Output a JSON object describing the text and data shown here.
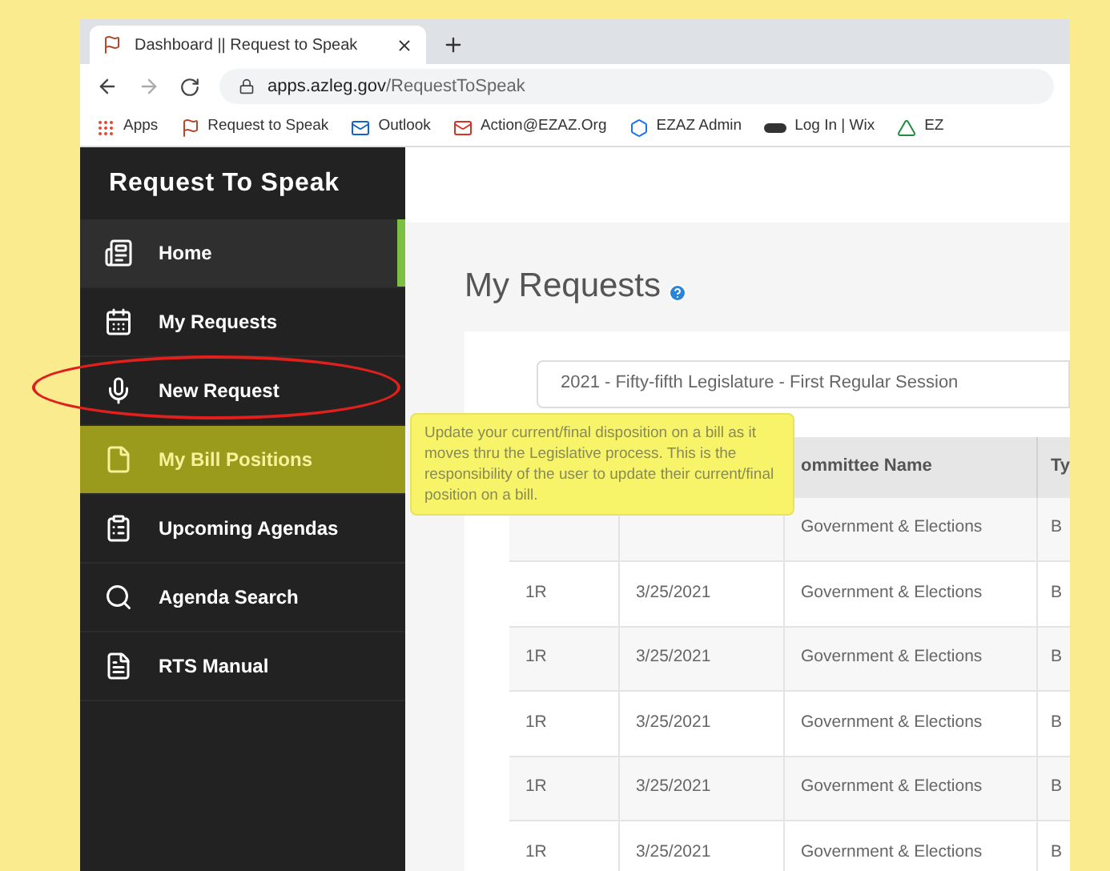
{
  "browser": {
    "tab_title": "Dashboard || Request to Speak",
    "url_domain": "apps.azleg.gov",
    "url_path": "/RequestToSpeak",
    "bookmarks": [
      {
        "label": "Apps",
        "kind": "grid"
      },
      {
        "label": "Request to Speak",
        "kind": "flag"
      },
      {
        "label": "Outlook",
        "kind": "mail"
      },
      {
        "label": "Action@EZAZ.Org",
        "kind": "gmail"
      },
      {
        "label": "EZAZ Admin",
        "kind": "hex"
      },
      {
        "label": "Log In | Wix",
        "kind": "wix"
      },
      {
        "label": "EZ",
        "kind": "drive"
      }
    ]
  },
  "sidebar": {
    "title": "Request To Speak",
    "items": [
      {
        "label": "Home",
        "kind": "home",
        "selected": true,
        "circled": false,
        "highlighted": false
      },
      {
        "label": "My Requests",
        "kind": "calendar",
        "selected": false,
        "circled": false,
        "highlighted": false
      },
      {
        "label": "New Request",
        "kind": "mic",
        "selected": false,
        "circled": true,
        "highlighted": false
      },
      {
        "label": "My Bill Positions",
        "kind": "doc",
        "selected": false,
        "circled": false,
        "highlighted": true
      },
      {
        "label": "Upcoming Agendas",
        "kind": "agenda",
        "selected": false,
        "circled": false,
        "highlighted": false
      },
      {
        "label": "Agenda Search",
        "kind": "search",
        "selected": false,
        "circled": false,
        "highlighted": false
      },
      {
        "label": "RTS Manual",
        "kind": "manual",
        "selected": false,
        "circled": false,
        "highlighted": false
      }
    ]
  },
  "page": {
    "title": "My Requests",
    "session_select": {
      "value": "2021 - Fifty-fifth Legislature - First Regular Session"
    }
  },
  "tooltip": {
    "text": "Update your current/final disposition on a bill as it moves thru the Legislative process. This is the responsibility of the user to update their current/final position on a bill."
  },
  "table": {
    "columns": [
      "ommittee Name",
      "Ty"
    ],
    "rows": [
      {
        "committee": "Government & Elections",
        "type": "B"
      },
      {
        "stage": "1R",
        "date": "3/25/2021",
        "committee": "Government & Elections",
        "type": "B"
      },
      {
        "stage": "1R",
        "date": "3/25/2021",
        "committee": "Government & Elections",
        "type": "B"
      },
      {
        "stage": "1R",
        "date": "3/25/2021",
        "committee": "Government & Elections",
        "type": "B"
      },
      {
        "stage": "1R",
        "date": "3/25/2021",
        "committee": "Government & Elections",
        "type": "B"
      },
      {
        "stage": "1R",
        "date": "3/25/2021",
        "committee": "Government & Elections",
        "type": "B"
      }
    ]
  }
}
